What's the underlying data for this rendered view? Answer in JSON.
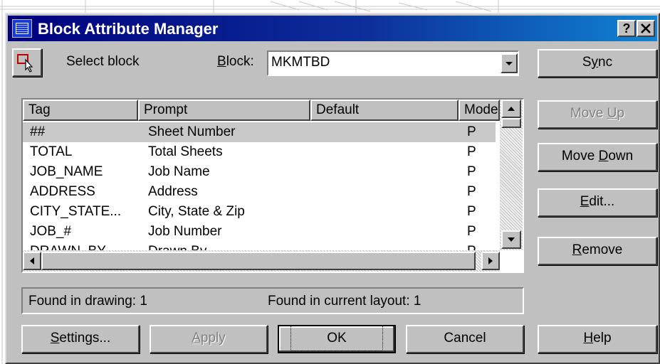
{
  "window": {
    "title": "Block Attribute Manager",
    "help_btn": "?",
    "close_btn": "✕"
  },
  "block_select": {
    "select_label": "Select block",
    "block_label": "Block:",
    "block_value": "MKMTBD"
  },
  "table": {
    "columns": [
      "Tag",
      "Prompt",
      "Default",
      "Mode"
    ],
    "rows": [
      {
        "tag": "##",
        "prompt": "Sheet Number",
        "default": "",
        "mode": "P"
      },
      {
        "tag": "TOTAL",
        "prompt": "Total Sheets",
        "default": "",
        "mode": "P"
      },
      {
        "tag": "JOB_NAME",
        "prompt": "Job Name",
        "default": "",
        "mode": "P"
      },
      {
        "tag": "ADDRESS",
        "prompt": "Address",
        "default": "",
        "mode": "P"
      },
      {
        "tag": "CITY_STATE...",
        "prompt": "City, State & Zip",
        "default": "",
        "mode": "P"
      },
      {
        "tag": "JOB_#",
        "prompt": "Job Number",
        "default": "",
        "mode": "P"
      },
      {
        "tag": "DRAWN_BY",
        "prompt": "Drawn By",
        "default": "",
        "mode": "P"
      }
    ],
    "selected_row": 0
  },
  "status": {
    "found_in_drawing": "Found in drawing: 1",
    "found_in_layout": "Found in current layout: 1"
  },
  "buttons": {
    "sync": "Sync",
    "move_up": "Move Up",
    "move_down": "Move Down",
    "edit": "Edit...",
    "remove": "Remove",
    "settings": "Settings...",
    "apply": "Apply",
    "ok": "OK",
    "cancel": "Cancel",
    "help": "Help"
  },
  "colors": {
    "title_start": "#000080",
    "title_end": "#1084d0",
    "face": "#c0c0c0",
    "selection": "#c8c8c8"
  }
}
